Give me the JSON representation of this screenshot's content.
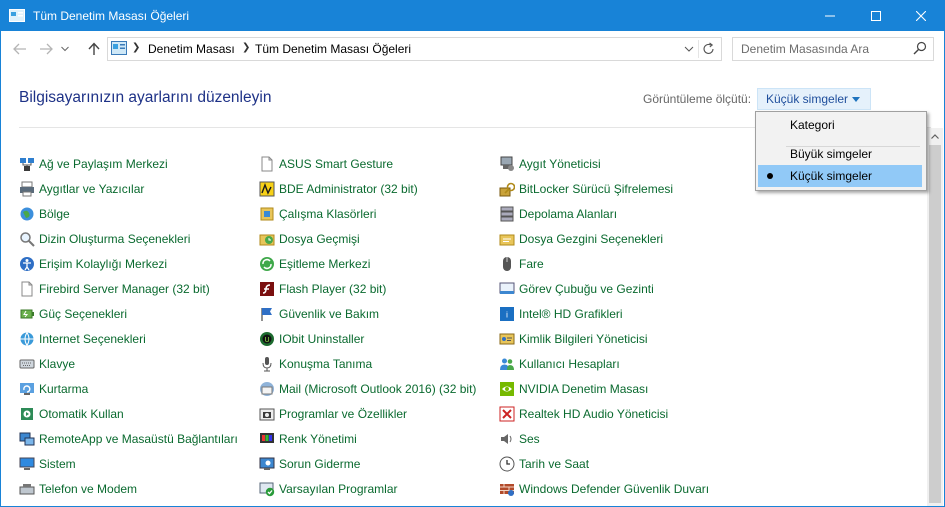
{
  "window": {
    "title": "Tüm Denetim Masası Öğeleri"
  },
  "address": {
    "crumbs": [
      "Denetim Masası",
      "Tüm Denetim Masası Öğeleri"
    ]
  },
  "search": {
    "placeholder": "Denetim Masasında Ara"
  },
  "heading": "Bilgisayarınızın ayarlarını düzenleyin",
  "view_by": {
    "label": "Görüntüleme ölçütü:",
    "value": "Küçük simgeler"
  },
  "view_menu": {
    "items": [
      "Kategori",
      "Büyük simgeler",
      "Küçük simgeler"
    ],
    "selected": "Küçük simgeler"
  },
  "columns": [
    [
      {
        "label": "Ağ ve Paylaşım Merkezi",
        "icon": "network-icon"
      },
      {
        "label": "Aygıtlar ve Yazıcılar",
        "icon": "printer-icon"
      },
      {
        "label": "Bölge",
        "icon": "globe-icon"
      },
      {
        "label": "Dizin Oluşturma Seçenekleri",
        "icon": "indexing-icon"
      },
      {
        "label": "Erişim Kolaylığı Merkezi",
        "icon": "accessibility-icon"
      },
      {
        "label": "Firebird Server Manager (32 bit)",
        "icon": "document-icon"
      },
      {
        "label": "Güç Seçenekleri",
        "icon": "power-icon"
      },
      {
        "label": "Internet Seçenekleri",
        "icon": "internet-icon"
      },
      {
        "label": "Klavye",
        "icon": "keyboard-icon"
      },
      {
        "label": "Kurtarma",
        "icon": "recovery-icon"
      },
      {
        "label": "Otomatik Kullan",
        "icon": "autoplay-icon"
      },
      {
        "label": "RemoteApp ve Masaüstü Bağlantıları",
        "icon": "remoteapp-icon"
      },
      {
        "label": "Sistem",
        "icon": "system-icon"
      },
      {
        "label": "Telefon ve Modem",
        "icon": "modem-icon"
      }
    ],
    [
      {
        "label": "ASUS Smart Gesture",
        "icon": "document-icon"
      },
      {
        "label": "BDE Administrator (32 bit)",
        "icon": "bde-icon"
      },
      {
        "label": "Çalışma Klasörleri",
        "icon": "work-folders-icon"
      },
      {
        "label": "Dosya Geçmişi",
        "icon": "file-history-icon"
      },
      {
        "label": "Eşitleme Merkezi",
        "icon": "sync-icon"
      },
      {
        "label": "Flash Player (32 bit)",
        "icon": "flash-icon"
      },
      {
        "label": "Güvenlik ve Bakım",
        "icon": "flag-icon"
      },
      {
        "label": "IObit Uninstaller",
        "icon": "iobit-icon"
      },
      {
        "label": "Konuşma Tanıma",
        "icon": "microphone-icon"
      },
      {
        "label": "Mail (Microsoft Outlook 2016) (32 bit)",
        "icon": "mail-icon"
      },
      {
        "label": "Programlar ve Özellikler",
        "icon": "programs-icon"
      },
      {
        "label": "Renk Yönetimi",
        "icon": "color-icon"
      },
      {
        "label": "Sorun Giderme",
        "icon": "troubleshoot-icon"
      },
      {
        "label": "Varsayılan Programlar",
        "icon": "default-programs-icon"
      }
    ],
    [
      {
        "label": "Aygıt Yöneticisi",
        "icon": "device-manager-icon"
      },
      {
        "label": "BitLocker Sürücü Şifrelemesi",
        "icon": "bitlocker-icon"
      },
      {
        "label": "Depolama Alanları",
        "icon": "storage-icon"
      },
      {
        "label": "Dosya Gezgini Seçenekleri",
        "icon": "folder-options-icon"
      },
      {
        "label": "Fare",
        "icon": "mouse-icon"
      },
      {
        "label": "Görev Çubuğu ve Gezinti",
        "icon": "taskbar-icon"
      },
      {
        "label": "Intel® HD Grafikleri",
        "icon": "intel-icon"
      },
      {
        "label": "Kimlik Bilgileri Yöneticisi",
        "icon": "credentials-icon"
      },
      {
        "label": "Kullanıcı Hesapları",
        "icon": "users-icon"
      },
      {
        "label": "NVIDIA Denetim Masası",
        "icon": "nvidia-icon"
      },
      {
        "label": "Realtek HD Audio Yöneticisi",
        "icon": "realtek-icon"
      },
      {
        "label": "Ses",
        "icon": "speaker-icon"
      },
      {
        "label": "Tarih ve Saat",
        "icon": "clock-icon"
      },
      {
        "label": "Windows Defender Güvenlik Duvarı",
        "icon": "firewall-icon"
      }
    ]
  ]
}
